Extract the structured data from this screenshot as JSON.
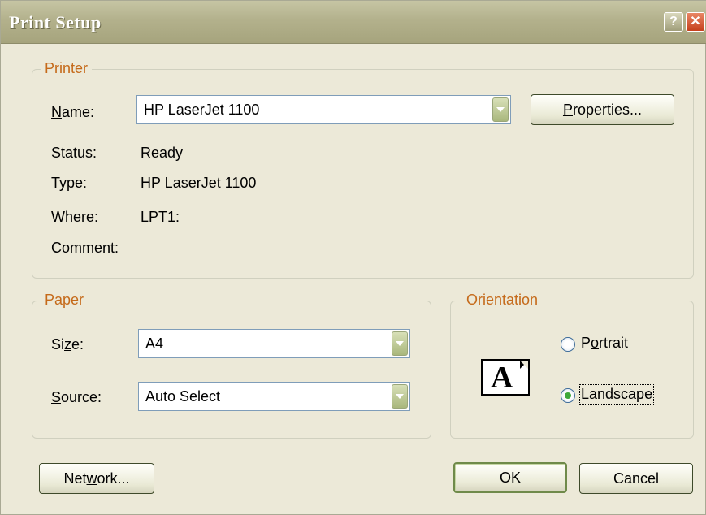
{
  "window": {
    "title": "Print Setup",
    "help_button": "?",
    "close_button": "✕"
  },
  "printer": {
    "legend": "Printer",
    "name_label_u": "N",
    "name_label_rest": "ame:",
    "name_value": "HP LaserJet 1100",
    "properties_u": "P",
    "properties_rest": "roperties...",
    "status_label": "Status:",
    "status_value": "Ready",
    "type_label": "Type:",
    "type_value": "HP LaserJet 1100",
    "where_label": "Where:",
    "where_value": "LPT1:",
    "comment_label": "Comment:",
    "comment_value": ""
  },
  "paper": {
    "legend": "Paper",
    "size_label_pre": "Si",
    "size_label_u": "z",
    "size_label_post": "e:",
    "size_value": "A4",
    "source_label_u": "S",
    "source_label_rest": "ource:",
    "source_value": "Auto Select"
  },
  "orientation": {
    "legend": "Orientation",
    "icon_letter": "A",
    "portrait_pre": "P",
    "portrait_u": "o",
    "portrait_post": "rtrait",
    "landscape_u": "L",
    "landscape_rest": "andscape",
    "selected": "Landscape"
  },
  "buttons": {
    "network_pre": "Net",
    "network_u": "w",
    "network_post": "ork...",
    "ok": "OK",
    "cancel": "Cancel"
  }
}
